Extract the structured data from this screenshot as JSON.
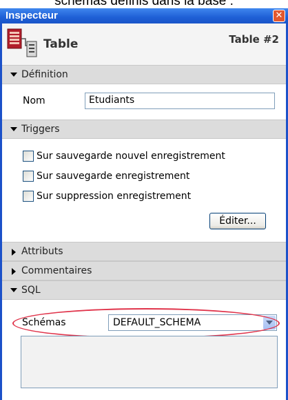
{
  "caption": "schémas définis dans la base :",
  "window": {
    "title": "Inspecteur",
    "close_glyph": "✕"
  },
  "header": {
    "icon": "table-icon",
    "title": "Table",
    "number": "Table #2"
  },
  "sections": {
    "definition": {
      "label": "Définition",
      "expanded": true
    },
    "triggers": {
      "label": "Triggers",
      "expanded": true
    },
    "attributs": {
      "label": "Attributs",
      "expanded": false
    },
    "commentaires": {
      "label": "Commentaires",
      "expanded": false
    },
    "sql": {
      "label": "SQL",
      "expanded": true
    }
  },
  "definition": {
    "name_label": "Nom",
    "name_value": "Etudiants"
  },
  "triggers": {
    "items": [
      {
        "label": "Sur sauvegarde nouvel enregistrement",
        "checked": false
      },
      {
        "label": "Sur sauvegarde enregistrement",
        "checked": false
      },
      {
        "label": "Sur suppression enregistrement",
        "checked": false
      }
    ],
    "edit_button": "Éditer..."
  },
  "sql": {
    "schemas_label": "Schémas",
    "schemas_value": "DEFAULT_SCHEMA"
  },
  "colors": {
    "titlebar": "#1e5fd6",
    "highlight": "#e0334a"
  }
}
